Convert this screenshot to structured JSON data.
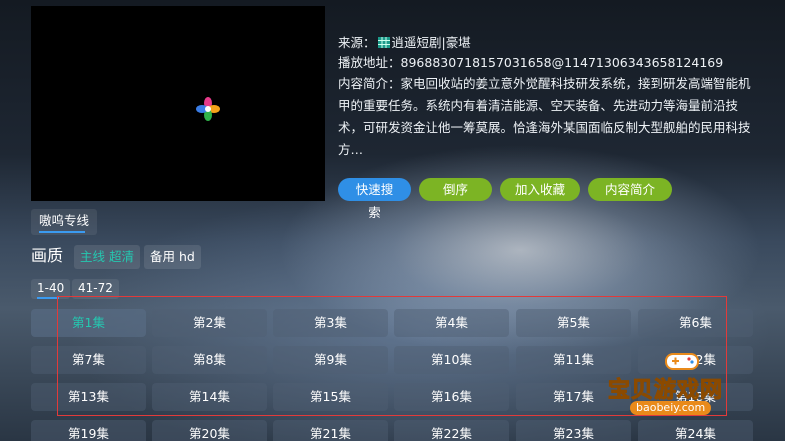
{
  "player": {
    "loading_icon": "pinwheel-loading-icon"
  },
  "info": {
    "source_label": "来源：",
    "source_icon": "grid-source-icon",
    "source_name": "逍遥短剧|豪堪",
    "play_address_label": "播放地址：",
    "play_address": "8968830718157031658@11471306343658124169",
    "description_label": "内容简介：",
    "description": "家电回收站的姜立意外觉醒科技研发系统，接到研发高端智能机甲的重要任务。系统内有着清洁能源、空天装备、先进动力等海量前沿技术，可研发资金让他一筹莫展。恰逢海外某国面临反制大型舰舶的民用科技方…"
  },
  "actions": {
    "search": "快速搜索",
    "reverse": "倒序",
    "favorite": "加入收藏",
    "intro": "内容简介"
  },
  "line": {
    "label": "嗷呜专线"
  },
  "quality": {
    "label": "画质",
    "options": [
      "主线 超清",
      "备用 hd"
    ]
  },
  "pages": [
    "1-40",
    "41-72"
  ],
  "episodes": [
    "第1集",
    "第2集",
    "第3集",
    "第4集",
    "第5集",
    "第6集",
    "第7集",
    "第8集",
    "第9集",
    "第10集",
    "第11集",
    "第12集",
    "第13集",
    "第14集",
    "第15集",
    "第16集",
    "第17集",
    "第18集",
    "第19集",
    "第20集",
    "第21集",
    "第22集",
    "第23集",
    "第24集"
  ],
  "watermark": {
    "title": "宝贝游戏网",
    "url": "baobeiy.com",
    "icon": "gamepad-icon"
  },
  "colors": {
    "accent_teal": "#25c7b0",
    "button_blue": "#2f8fe6",
    "button_green": "#7cb424",
    "highlight_red": "#e23a3a"
  }
}
